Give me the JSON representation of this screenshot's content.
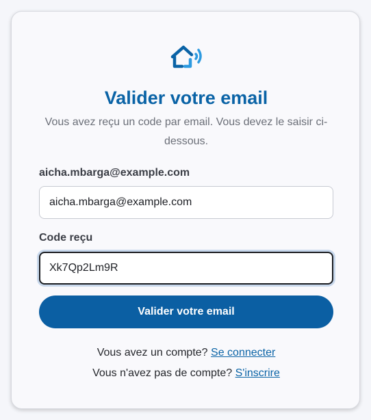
{
  "header": {
    "logo_icon": "smart-home-icon",
    "title": "Valider votre email",
    "subtitle": "Vous avez reçu un code par email. Vous devez le saisir ci-dessous."
  },
  "form": {
    "email_label": "aicha.mbarga@example.com",
    "email_value": "aicha.mbarga@example.com",
    "code_label": "Code reçu",
    "code_value": "Xk7Qp2Lm9R",
    "submit_label": "Valider votre email"
  },
  "footer": {
    "login_prompt": "Vous avez un compte?",
    "login_link": "Se connecter",
    "signup_prompt": "Vous n'avez pas de compte?",
    "signup_link": "S'inscrire"
  },
  "colors": {
    "accent": "#0b5fa3",
    "title": "#0a63a6",
    "logo_light": "#2d9ae0"
  }
}
